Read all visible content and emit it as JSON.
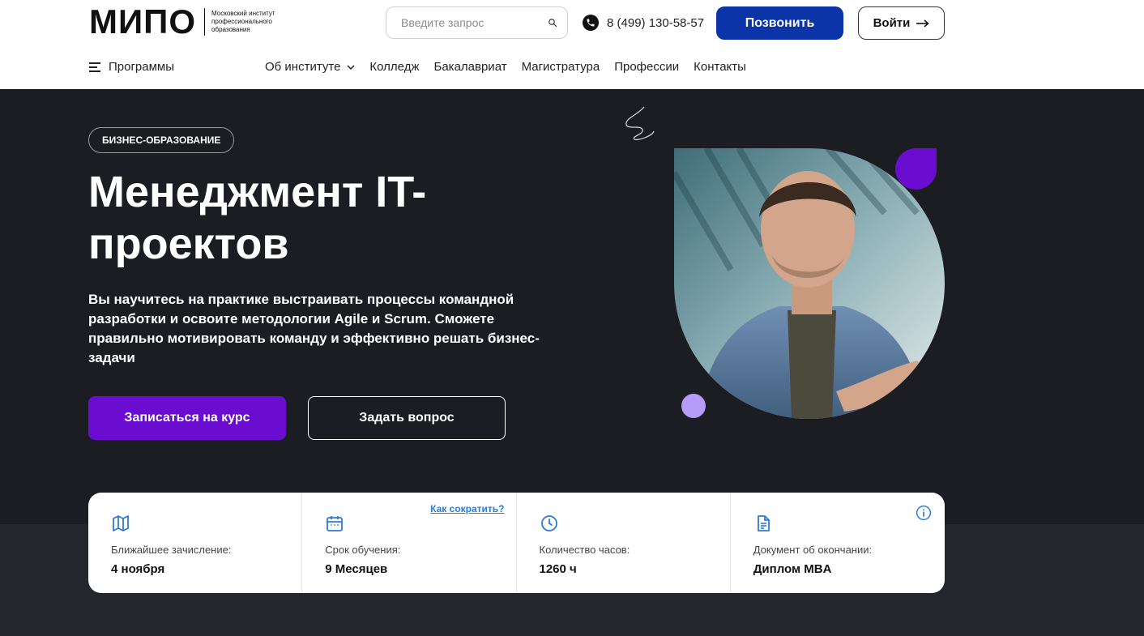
{
  "header": {
    "logo_mark": "МИПО",
    "logo_subtitle": "Московский институт профессионального образования",
    "search_placeholder": "Введите запрос",
    "phone": "8 (499) 130-58-57",
    "call_label": "Позвонить",
    "login_label": "Войти"
  },
  "nav": {
    "programs_label": "Программы",
    "links": [
      {
        "label": "Об институте",
        "has_dropdown": true
      },
      {
        "label": "Колледж"
      },
      {
        "label": "Бакалавриат"
      },
      {
        "label": "Магистратура"
      },
      {
        "label": "Профессии"
      },
      {
        "label": "Контакты"
      }
    ]
  },
  "hero": {
    "badge": "БИЗНЕС-ОБРАЗОВАНИЕ",
    "title": "Менеджмент IT-проектов",
    "description": "Вы научитесь на практике выстраивать процессы командной разработки и освоите методологии Agile и Scrum. Сможете правильно мотивировать команду и эффективно решать бизнес-задачи",
    "enroll_label": "Записаться на курс",
    "ask_label": "Задать вопрос"
  },
  "info": {
    "shorten_link": "Как сократить?",
    "cells": [
      {
        "icon": "map-icon",
        "label": "Ближайшее зачисление:",
        "value": "4 ноября"
      },
      {
        "icon": "calendar-icon",
        "label": "Срок обучения:",
        "value": "9 Месяцев"
      },
      {
        "icon": "clock-icon",
        "label": "Количество часов:",
        "value": "1260 ч"
      },
      {
        "icon": "document-icon",
        "label": "Документ об окончании:",
        "value": "Диплом MBA"
      }
    ]
  },
  "colors": {
    "brand_blue": "#0a34a8",
    "accent_purple": "#6a0dd1",
    "hero_bg": "#1b1d22",
    "link_blue": "#2b7bd8",
    "lilac": "#b49cf8"
  }
}
